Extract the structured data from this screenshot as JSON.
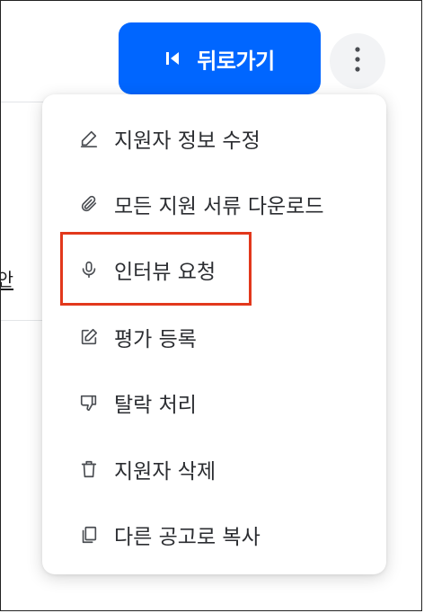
{
  "background": {
    "partial_label": "안"
  },
  "header": {
    "back_button_label": "뒤로가기",
    "more_button_icon": "more-vertical-icon"
  },
  "menu": {
    "items": [
      {
        "label": "지원자 정보 수정",
        "icon": "pencil-icon"
      },
      {
        "label": "모든 지원 서류 다운로드",
        "icon": "paperclip-icon"
      },
      {
        "label": "인터뷰 요청",
        "icon": "microphone-icon"
      },
      {
        "label": "평가 등록",
        "icon": "edit-square-icon"
      },
      {
        "label": "탈락 처리",
        "icon": "thumbs-down-icon"
      },
      {
        "label": "지원자 삭제",
        "icon": "trash-icon"
      },
      {
        "label": "다른 공고로 복사",
        "icon": "copy-icon"
      }
    ]
  },
  "colors": {
    "primary": "#0066ff",
    "highlight_border": "#e2381c",
    "text": "#2b2d31"
  }
}
